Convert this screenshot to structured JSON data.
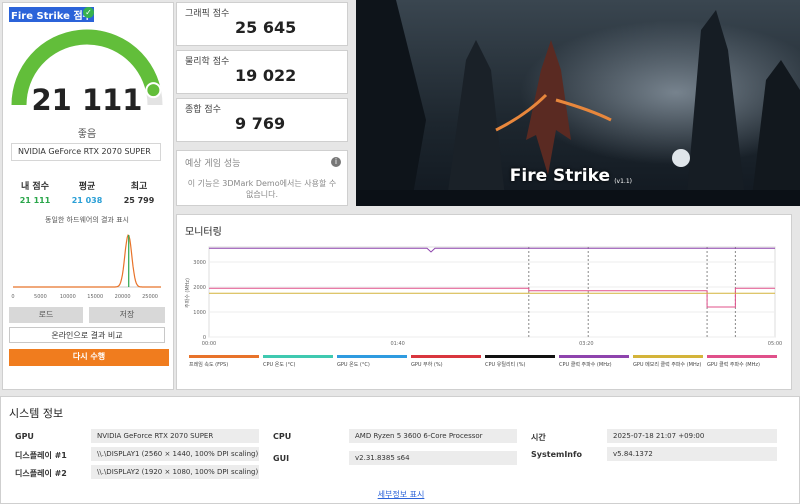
{
  "score_panel": {
    "title": "Fire Strike 점수",
    "main_score": "21 111",
    "gauge_fraction": 0.93,
    "rating": "좋음",
    "gpu_name": "NVIDIA GeForce RTX 2070 SUPER",
    "stats": [
      {
        "label": "내 점수",
        "value": "21 111",
        "color": "#2aa64a"
      },
      {
        "label": "평균",
        "value": "21 038",
        "color": "#2a9fd6"
      },
      {
        "label": "최고",
        "value": "25 799",
        "color": "#333333"
      }
    ],
    "compare_title": "동일한 하드웨어의 결과 표시",
    "distribution": {
      "x_ticks": [
        "0",
        "5000",
        "10000",
        "15000",
        "20000",
        "25000"
      ],
      "xlim": [
        0,
        27000
      ],
      "peak_center": 21038,
      "my_score": 21111
    },
    "load_button": "로드",
    "save_button": "저장",
    "online_button": "온라인으로 결과 비교",
    "run_button": "다시 수행"
  },
  "sub_scores": [
    {
      "label": "그래픽 점수",
      "value": "25 645"
    },
    {
      "label": "물리학 점수",
      "value": "19 022"
    },
    {
      "label": "종합 점수",
      "value": "9 769"
    }
  ],
  "game_performance": {
    "title": "예상 게임 성능",
    "message": "이 기능은 3DMark Demo에서는 사용할 수 없습니다."
  },
  "hero": {
    "title": "Fire Strike",
    "version": "(v1.1)"
  },
  "monitoring": {
    "title": "모니터링",
    "y_axis_label": "주파수 (MHz)",
    "y_ticks": [
      "3000",
      "2000",
      "1000",
      "0"
    ],
    "x_ticks": [
      "00:00",
      "01:40",
      "03:20",
      "05:00"
    ],
    "legend": [
      {
        "label": "프레임 속도 (FPS)",
        "color": "#e8732a"
      },
      {
        "label": "CPU 온도 (°C)",
        "color": "#3fc9b0"
      },
      {
        "label": "GPU 온도 (°C)",
        "color": "#2f9be0"
      },
      {
        "label": "GPU 부하 (%)",
        "color": "#d9363e"
      },
      {
        "label": "CPU 유틸리티 (%)",
        "color": "#111111"
      },
      {
        "label": "CPU 클럭 주파수 (MHz)",
        "color": "#8e44ad"
      },
      {
        "label": "GPU 메모리 클럭 주파수 (MHz)",
        "color": "#d4b43a"
      },
      {
        "label": "GPU 클럭 주파수 (MHz)",
        "color": "#e0508a"
      }
    ]
  },
  "system_info": {
    "title": "시스템 정보",
    "rows": [
      {
        "label": "GPU",
        "value": "NVIDIA GeForce RTX 2070 SUPER"
      },
      {
        "label": "디스플레이 #1",
        "value": "\\\\.\\DISPLAY1 (2560 × 1440, 100% DPI scaling)"
      },
      {
        "label": "디스플레이 #2",
        "value": "\\\\.\\DISPLAY2 (1920 × 1080, 100% DPI scaling)"
      },
      {
        "label": "CPU",
        "value": "AMD Ryzen 5 3600 6-Core Processor"
      },
      {
        "label": "GUI",
        "value": "v2.31.8385 s64"
      },
      {
        "label": "시간",
        "value": "2025-07-18 21:07 +09:00"
      },
      {
        "label": "SystemInfo",
        "value": "v5.84.1372"
      }
    ],
    "details_link": "세부정보 표시"
  }
}
